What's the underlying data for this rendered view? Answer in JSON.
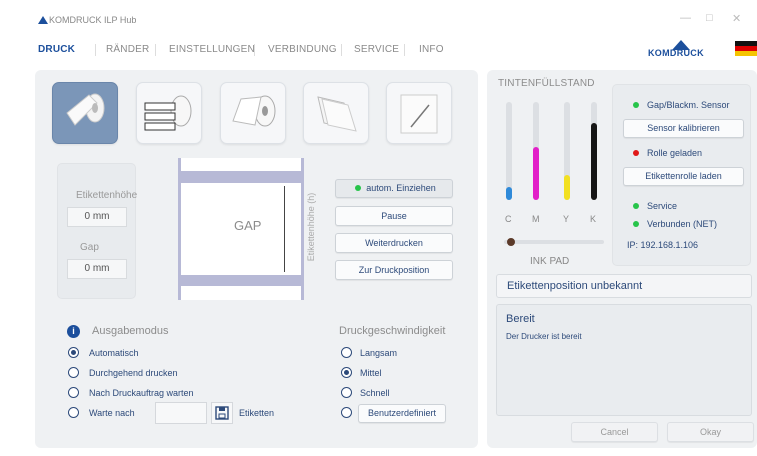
{
  "app": {
    "title": "KOMDRUCK ILP Hub",
    "window_controls": [
      "—",
      "□",
      "✕"
    ]
  },
  "tabs": [
    "DRUCK",
    "RÄNDER",
    "EINSTELLUNGEN",
    "VERBINDUNG",
    "SERVICE",
    "INFO"
  ],
  "active_tab": "DRUCK",
  "brand": {
    "name": "KOMDRUCK",
    "logo_text": "KOMDRUCK"
  },
  "label_types": [
    "roll-label",
    "fanfold-label",
    "roll-continuous",
    "sheet-stack",
    "single-sheet"
  ],
  "label_settings": {
    "height_label": "Etikettenhöhe",
    "height_value": "0 mm",
    "gap_label": "Gap",
    "gap_value": "0 mm"
  },
  "preview": {
    "gap_text": "GAP",
    "axis_label": "Etikettenhöhe (h)"
  },
  "actions": {
    "auto_feed_label": "autom. Einziehen",
    "pause": "Pause",
    "resume": "Weiterdrucken",
    "to_print_position": "Zur Druckposition"
  },
  "output_mode": {
    "title": "Ausgabemodus",
    "options": [
      "Automatisch",
      "Durchgehend drucken",
      "Nach Druckauftrag warten",
      "Warte nach"
    ],
    "selected": "Automatisch",
    "wait_after_suffix": "Etiketten",
    "wait_after_value": ""
  },
  "print_speed": {
    "title": "Druckgeschwindigkeit",
    "options": [
      "Langsam",
      "Mittel",
      "Schnell",
      "Benutzerdefiniert"
    ],
    "selected": "Mittel"
  },
  "ink": {
    "title": "TINTENFÜLLSTAND",
    "channels": [
      {
        "label": "C",
        "color": "#2f8ad9",
        "level": 0.13
      },
      {
        "label": "M",
        "color": "#e21fc8",
        "level": 0.54
      },
      {
        "label": "Y",
        "color": "#f2e021",
        "level": 0.26
      },
      {
        "label": "K",
        "color": "#151515",
        "level": 0.79
      }
    ],
    "ink_pad_label": "INK PAD",
    "ink_pad_level": 0.03
  },
  "status": {
    "gap_sensor": "Gap/Blackm. Sensor",
    "calibrate": "Sensor kalibrieren",
    "roll_loaded": "Rolle geladen",
    "load_roll": "Etikettenrolle laden",
    "service": "Service",
    "connected": "Verbunden (NET)",
    "ip": "IP: 192.168.1.106",
    "colors": {
      "ok": "#27c44a",
      "error": "#e01818"
    }
  },
  "label_position": "Etikettenposition unbekannt",
  "printer_state": {
    "title": "Bereit",
    "message": "Der Drucker ist bereit"
  },
  "dialog": {
    "cancel": "Cancel",
    "ok": "Okay"
  }
}
